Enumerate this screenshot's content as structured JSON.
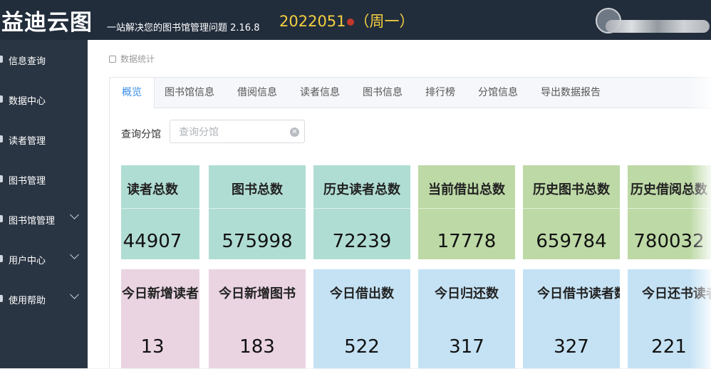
{
  "header": {
    "brand": "益迪云图",
    "subtitle": "一站解决您的图书馆管理问题 2.16.8",
    "date_prefix": "2022051",
    "date_suffix": "（周一）"
  },
  "sidebar": {
    "items": [
      {
        "label": "信息查询",
        "expandable": false
      },
      {
        "label": "数据中心",
        "expandable": false
      },
      {
        "label": "读者管理",
        "expandable": false
      },
      {
        "label": "图书管理",
        "expandable": false
      },
      {
        "label": "图书馆管理",
        "expandable": true
      },
      {
        "label": "用户中心",
        "expandable": true
      },
      {
        "label": "使用帮助",
        "expandable": true
      }
    ]
  },
  "breadcrumb": {
    "label": "数据统计",
    "icon": "calendar-icon"
  },
  "tabs": [
    {
      "label": "概览",
      "active": true
    },
    {
      "label": "图书馆信息",
      "active": false
    },
    {
      "label": "借阅信息",
      "active": false
    },
    {
      "label": "读者信息",
      "active": false
    },
    {
      "label": "图书信息",
      "active": false
    },
    {
      "label": "排行榜",
      "active": false
    },
    {
      "label": "分馆信息",
      "active": false
    },
    {
      "label": "导出数据报告",
      "active": false
    }
  ],
  "search": {
    "label": "查询分馆",
    "placeholder": "查询分馆",
    "value": ""
  },
  "stats_row1": [
    {
      "label": "读者总数",
      "value": "44907"
    },
    {
      "label": "图书总数",
      "value": "575998"
    },
    {
      "label": "历史读者总数",
      "value": "72239"
    },
    {
      "label": "当前借出总数",
      "value": "17778"
    },
    {
      "label": "历史图书总数",
      "value": "659784"
    },
    {
      "label": "历史借阅总数",
      "value": "780032"
    }
  ],
  "stats_row2": [
    {
      "label": "今日新增读者",
      "value": "13"
    },
    {
      "label": "今日新增图书",
      "value": "183"
    },
    {
      "label": "今日借出数",
      "value": "522"
    },
    {
      "label": "今日归还数",
      "value": "317"
    },
    {
      "label": "今日借书读者数",
      "value": "327"
    },
    {
      "label": "今日还书读者数",
      "value": "221"
    }
  ],
  "colors": {
    "header_bg": "#222d3c",
    "sidebar_bg": "#2a3543",
    "date": "#f4d03f",
    "tab_active": "#3a8ee6",
    "teal": "#b0ddd3",
    "green": "#bdd9a6",
    "pink": "#ead4e2",
    "blue": "#c5e2f4"
  }
}
